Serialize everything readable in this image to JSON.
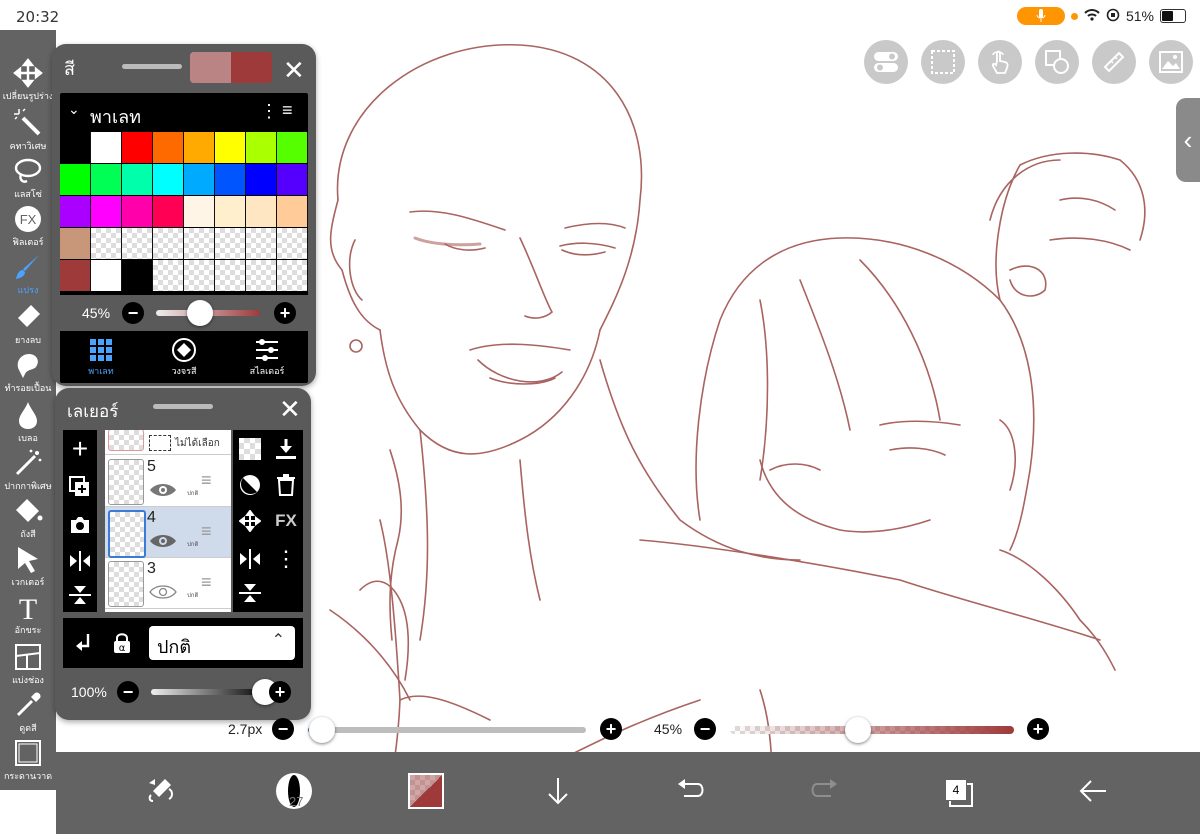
{
  "status": {
    "time": "20:32",
    "battery": "51%",
    "battery_level": 0.51
  },
  "left_toolbar": {
    "tools": [
      {
        "label": "เปลี่ยนรูปร่าง",
        "icon": "move-icon"
      },
      {
        "label": "คทาวิเศษ",
        "icon": "magic-wand-icon"
      },
      {
        "label": "แลสโซ่",
        "icon": "lasso-icon"
      },
      {
        "label": "ฟิลเตอร์",
        "icon": "fx-icon"
      },
      {
        "label": "แปรง",
        "icon": "brush-icon",
        "active": true
      },
      {
        "label": "ยางลบ",
        "icon": "eraser-icon"
      },
      {
        "label": "ทำรอยเปื้อน",
        "icon": "smudge-icon"
      },
      {
        "label": "เบลอ",
        "icon": "blur-icon"
      },
      {
        "label": "ปากกาพิเศษ",
        "icon": "special-pen-icon"
      },
      {
        "label": "ถังสี",
        "icon": "bucket-icon"
      },
      {
        "label": "เวกเตอร์",
        "icon": "vector-icon"
      },
      {
        "label": "อักขระ",
        "icon": "text-icon"
      },
      {
        "label": "แบ่งช่อง",
        "icon": "frame-divider-icon"
      },
      {
        "label": "ดูดสี",
        "icon": "eyedropper-icon"
      },
      {
        "label": "กระดานวาด",
        "icon": "canvas-icon"
      }
    ]
  },
  "color_panel": {
    "title": "สี",
    "palette_title": "พาเลท",
    "opacity_label": "45%",
    "opacity_value": 0.45,
    "swatch_rows": [
      [
        "#000000",
        "#ffffff",
        "#ff0000",
        "#ff6a00",
        "#ffaa00",
        "#ffff00",
        "#aaff00",
        "#55ff00"
      ],
      [
        "#00ff00",
        "#00ff55",
        "#00ffaa",
        "#00ffff",
        "#00aaff",
        "#0055ff",
        "#0000ff",
        "#5500ff"
      ],
      [
        "#aa00ff",
        "#ff00ff",
        "#ff00aa",
        "#ff0055",
        "#fff5e6",
        "#ffefcc",
        "#ffe6c2",
        "#ffcc99"
      ],
      [
        "#c8977a",
        "checker",
        "checker",
        "checker",
        "checker",
        "checker",
        "checker",
        "checker"
      ],
      [
        "#9e3a3a",
        "#ffffff",
        "#000000",
        "checker",
        "checker",
        "checker",
        "checker",
        "checker"
      ]
    ],
    "tabs": [
      {
        "label": "พาเลท",
        "icon": "palette-grid-icon",
        "active": true
      },
      {
        "label": "วงจรสี",
        "icon": "color-wheel-icon"
      },
      {
        "label": "สไลเดอร์",
        "icon": "sliders-icon"
      }
    ]
  },
  "layer_panel": {
    "title": "เลเยอร์",
    "selection_label": "ไม่ได้เลือก",
    "layers": [
      {
        "number": "5",
        "mode": "ปกติ",
        "selected": false
      },
      {
        "number": "4",
        "mode": "ปกติ",
        "selected": true
      },
      {
        "number": "3",
        "mode": "ปกติ",
        "selected": false
      }
    ],
    "blend_mode": "ปกติ",
    "opacity_label": "100%",
    "opacity_value": 1.0,
    "fx_label": "FX"
  },
  "brush": {
    "size_label": "2.7px",
    "opacity_label": "45%",
    "size_value": 0.05,
    "opacity_value": 0.45
  },
  "bottom_bar": {
    "brush_size_label": "27",
    "layer_count": "4",
    "color": "#9e3a3a"
  },
  "colors": {
    "accent": "#4aa3ff",
    "toolbar": "#636363",
    "sketch": "#a0534f"
  }
}
